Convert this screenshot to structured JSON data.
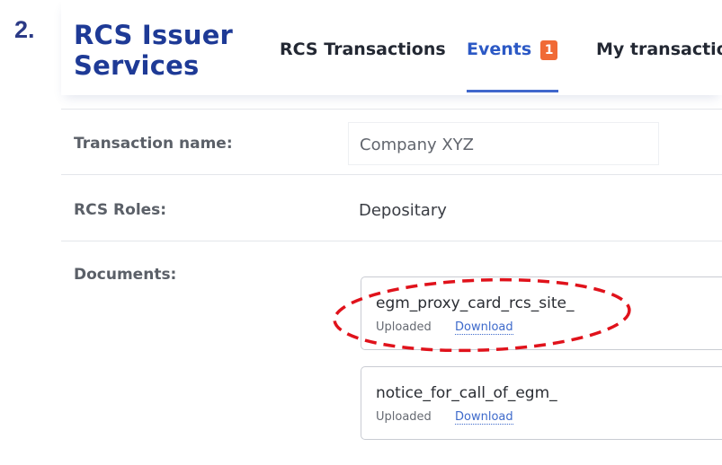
{
  "step": {
    "number": "2."
  },
  "header": {
    "brand_line1": "RCS Issuer",
    "brand_line2": "Services",
    "tabs": [
      {
        "label": "RCS Transactions",
        "active": false
      },
      {
        "label": "Events",
        "active": true,
        "badge": "1"
      },
      {
        "label": "My transaction",
        "active": false
      }
    ]
  },
  "form": {
    "transaction_name": {
      "label": "Transaction name:",
      "value": "Company XYZ"
    },
    "rcs_roles": {
      "label": "RCS Roles:",
      "value": "Depositary"
    },
    "documents": {
      "label": "Documents:",
      "items": [
        {
          "name": "egm_proxy_card_rcs_site_",
          "status": "Uploaded",
          "action": "Download",
          "highlighted": true
        },
        {
          "name": "notice_for_call_of_egm_",
          "status": "Uploaded",
          "action": "Download",
          "highlighted": false
        }
      ]
    }
  },
  "colors": {
    "brand": "#1e3a96",
    "step_number": "#2b3a86",
    "active_tab": "#2c59c5",
    "badge": "#f06a36",
    "link": "#3e6acb",
    "highlight": "#e0121b"
  }
}
